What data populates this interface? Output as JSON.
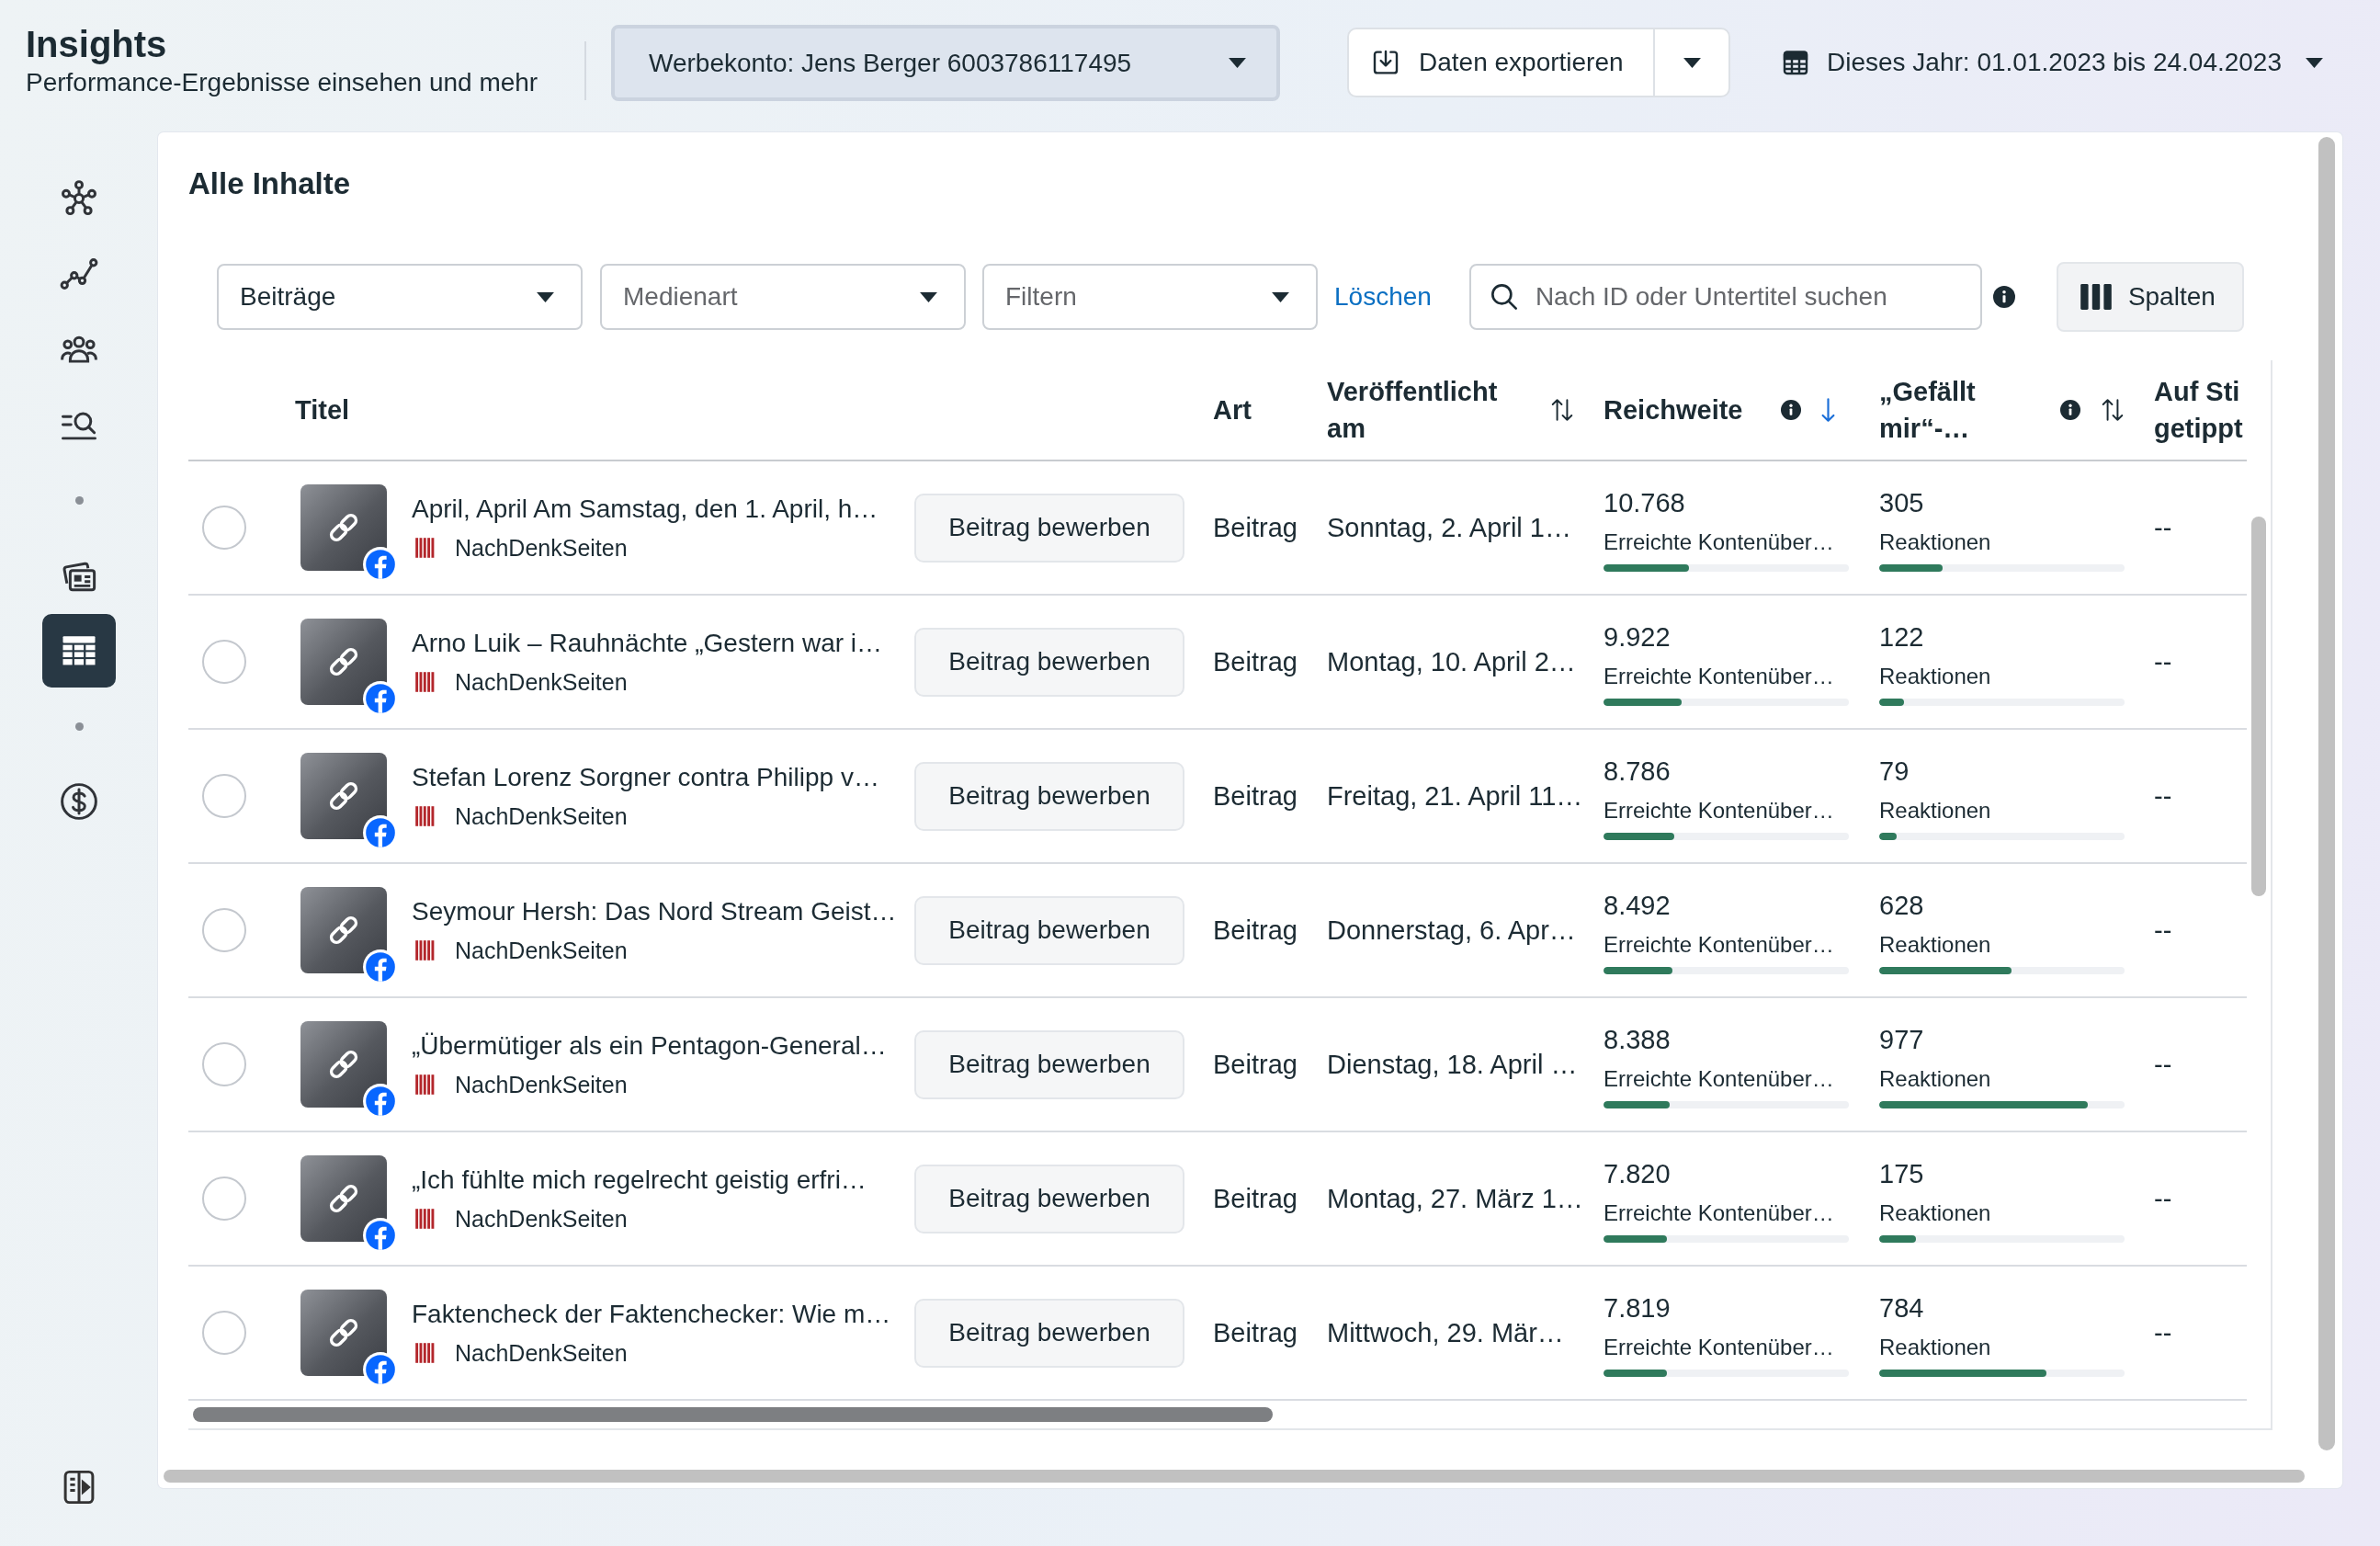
{
  "header": {
    "title": "Insights",
    "subtitle": "Performance-Ergebnisse einsehen und mehr",
    "account": "Werbekonto: Jens Berger 6003786117495",
    "export_button": "Daten exportieren",
    "date_range": "Dieses Jahr: 01.01.2023 bis 24.04.2023"
  },
  "sidebar": {
    "items": [
      {
        "kind": "nav",
        "selected": false
      },
      {
        "kind": "nav",
        "selected": false
      },
      {
        "kind": "nav",
        "selected": false
      },
      {
        "kind": "nav",
        "selected": false
      },
      {
        "kind": "dot"
      },
      {
        "kind": "nav",
        "selected": false
      },
      {
        "kind": "nav",
        "selected": true
      },
      {
        "kind": "dot"
      },
      {
        "kind": "nav",
        "selected": false
      }
    ]
  },
  "panel": {
    "title": "Alle Inhalte",
    "filters": [
      {
        "value": "Beiträge"
      },
      {
        "placeholder": "Medienart"
      },
      {
        "placeholder": "Filtern"
      }
    ],
    "clear_link": "Löschen",
    "search": {
      "placeholder": "Nach ID oder Untertitel suchen"
    },
    "columns_button": "Spalten"
  },
  "table": {
    "columns": [
      {
        "label": "Titel",
        "info": false,
        "sortable": false
      },
      {
        "label": "Art",
        "info": false,
        "sortable": false
      },
      {
        "label": "Veröffentlicht am",
        "info": false,
        "sortable": true,
        "sorted": false
      },
      {
        "label": "Reichweite",
        "info": true,
        "sortable": true,
        "sorted": true
      },
      {
        "label": "„Gefällt mir“-…",
        "info": true,
        "sortable": true,
        "sorted": false
      },
      {
        "label": "Auf Sti getippt",
        "info": false,
        "sortable": false
      }
    ],
    "rows": [
      {
        "selected": false,
        "title": "April, April Am Samstag, den 1. April, h…",
        "source": "NachDenkSeiten",
        "promote_button": "Beitrag bewerben",
        "type": "Beitrag",
        "published": "Sonntag, 2. April 1…",
        "reach": {
          "value": "10.768",
          "label": "Erreichte Kontenüber…",
          "level": 0.35
        },
        "reactions": {
          "value": "305",
          "label": "Reaktionen",
          "level": 0.26
        },
        "sticker_taps": "--"
      },
      {
        "selected": false,
        "title": "Arno Luik – Rauhnächte „Gestern war i…",
        "source": "NachDenkSeiten",
        "promote_button": "Beitrag bewerben",
        "type": "Beitrag",
        "published": "Montag, 10. April 2…",
        "reach": {
          "value": "9.922",
          "label": "Erreichte Kontenüber…",
          "level": 0.32
        },
        "reactions": {
          "value": "122",
          "label": "Reaktionen",
          "level": 0.1
        },
        "sticker_taps": "--"
      },
      {
        "selected": false,
        "title": "Stefan Lorenz Sorgner contra Philipp v…",
        "source": "NachDenkSeiten",
        "promote_button": "Beitrag bewerben",
        "type": "Beitrag",
        "published": "Freitag, 21. April 11…",
        "reach": {
          "value": "8.786",
          "label": "Erreichte Kontenüber…",
          "level": 0.29
        },
        "reactions": {
          "value": "79",
          "label": "Reaktionen",
          "level": 0.07
        },
        "sticker_taps": "--"
      },
      {
        "selected": false,
        "title": "Seymour Hersh: Das Nord Stream Geist…",
        "source": "NachDenkSeiten",
        "promote_button": "Beitrag bewerben",
        "type": "Beitrag",
        "published": "Donnerstag, 6. Apr…",
        "reach": {
          "value": "8.492",
          "label": "Erreichte Kontenüber…",
          "level": 0.28
        },
        "reactions": {
          "value": "628",
          "label": "Reaktionen",
          "level": 0.54
        },
        "sticker_taps": "--"
      },
      {
        "selected": false,
        "title": "„Übermütiger als ein Pentagon-General…",
        "source": "NachDenkSeiten",
        "promote_button": "Beitrag bewerben",
        "type": "Beitrag",
        "published": "Dienstag, 18. April …",
        "reach": {
          "value": "8.388",
          "label": "Erreichte Kontenüber…",
          "level": 0.27
        },
        "reactions": {
          "value": "977",
          "label": "Reaktionen",
          "level": 0.85
        },
        "sticker_taps": "--"
      },
      {
        "selected": false,
        "title": "„Ich fühlte mich regelrecht geistig erfri…",
        "source": "NachDenkSeiten",
        "promote_button": "Beitrag bewerben",
        "type": "Beitrag",
        "published": "Montag, 27. März 1…",
        "reach": {
          "value": "7.820",
          "label": "Erreichte Kontenüber…",
          "level": 0.26
        },
        "reactions": {
          "value": "175",
          "label": "Reaktionen",
          "level": 0.15
        },
        "sticker_taps": "--"
      },
      {
        "selected": false,
        "title": "Faktencheck der Faktenchecker: Wie m…",
        "source": "NachDenkSeiten",
        "promote_button": "Beitrag bewerben",
        "type": "Beitrag",
        "published": "Mittwoch, 29. Mär…",
        "reach": {
          "value": "7.819",
          "label": "Erreichte Kontenüber…",
          "level": 0.26
        },
        "reactions": {
          "value": "784",
          "label": "Reaktionen",
          "level": 0.68
        },
        "sticker_taps": "--"
      }
    ]
  }
}
